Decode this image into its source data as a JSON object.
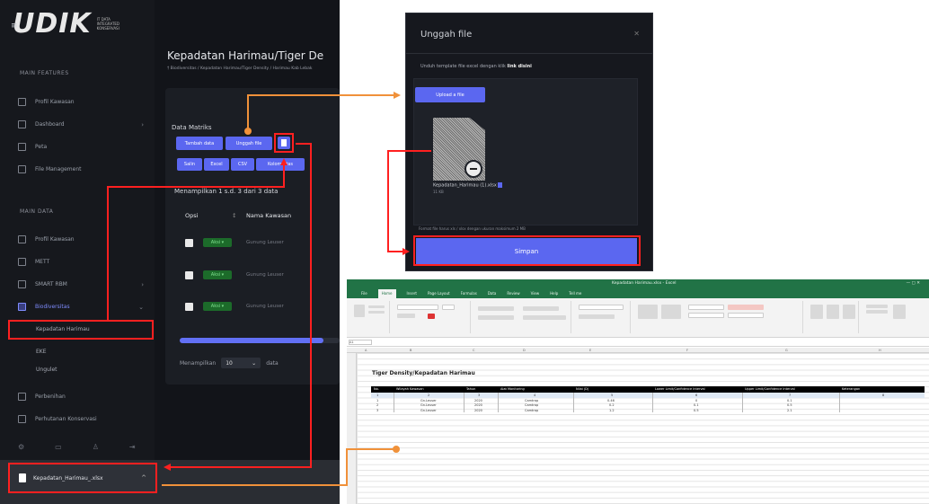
{
  "app": {
    "logo": "UDIK",
    "logo_tagline": "IT DATA INTEGRATED KONSERVASI",
    "sidebar": {
      "section_main": "MAIN FEATURES",
      "main_items": [
        {
          "label": "Profil Kawasan"
        },
        {
          "label": "Dashboard"
        },
        {
          "label": "Peta"
        },
        {
          "label": "File Management"
        }
      ],
      "section_data": "MAIN DATA",
      "data_items": [
        {
          "label": "Profil Kawasan"
        },
        {
          "label": "METT"
        },
        {
          "label": "SMART RBM"
        },
        {
          "label": "Biodiversitas"
        }
      ],
      "sub_items": [
        {
          "label": "Kepadatan Harimau"
        },
        {
          "label": "EKE"
        },
        {
          "label": "Ungulet"
        }
      ],
      "bottom_items": [
        {
          "label": "Perbenihan"
        },
        {
          "label": "Perhutanan Konservasi"
        }
      ]
    },
    "page_title": "Kepadatan Harimau/Tiger De",
    "breadcrumb": "† Biodiversitas  /  Kepadatan Harimau/Tiger Density  /  Harimau Kab Lebak",
    "data_label": "Data Matriks",
    "buttons": {
      "add": "Tambah data",
      "upload": "Unggah file",
      "exports": [
        "Salin",
        "Excel",
        "CSV",
        "Kolom Atas"
      ]
    },
    "showing": "Menampilkan 1 s.d. 3 dari 3 data",
    "table_headers": {
      "opsi": "Opsi",
      "nama": "Nama Kawasan"
    },
    "rows": [
      {
        "badge": "Aksi ▾",
        "text": "Gunung Leuser"
      },
      {
        "badge": "Aksi ▾",
        "text": "Gunung Leuser"
      },
      {
        "badge": "Aksi ▾",
        "text": "Gunung Leuser"
      }
    ],
    "progress": 0.9,
    "show_entries": {
      "prefix": "Menampilkan",
      "value": "10",
      "suffix": "data"
    },
    "download": {
      "filename": "Kepadatan_Harimau_.xlsx"
    }
  },
  "modal": {
    "title": "Unggah file",
    "hint_prefix": "Unduh template file excel dengan klik",
    "hint_bold": "link disini",
    "upload_button": "Upload a file",
    "file_name": "Kepadatan_Harimau (1).xlsx",
    "file_size": "11 KB",
    "note": "Format file harus xls / xlsx dengan ukuran maksimum 2 MB",
    "save_button": "Simpan"
  },
  "excel": {
    "window_title": "Kepadatan Harimau.xlsx - Excel",
    "window_controls": "— ▢ ✕",
    "tabs": [
      "File",
      "Home",
      "Insert",
      "Page Layout",
      "Formulas",
      "Data",
      "Review",
      "View",
      "Help",
      "Tell me"
    ],
    "name_box": "A1",
    "sheet_title": "Tiger Density/Kepadatan Harimau",
    "columns": [
      "No.",
      "Wilayah Kawasan",
      "Tahun",
      "Alat Monitoring",
      "Nilai (D)",
      "Lower Limit/Confidence Interval",
      "Upper Limit/Confidence Interval",
      "Keterangan"
    ],
    "rows": [
      [
        "1",
        "2",
        "3",
        "4",
        "5",
        "6",
        "7",
        "8"
      ],
      [
        "1",
        "Gn.Leuser",
        "2020",
        "Camtrap",
        "0.46",
        "0",
        "0.1",
        ""
      ],
      [
        "2",
        "Gn.Leuser",
        "2020",
        "Camtrap",
        "0.2",
        "0.1",
        "0.5",
        ""
      ],
      [
        "3",
        "Gn.Leuser",
        "2020",
        "Camtrap",
        "1.2",
        "0.5",
        "2.1",
        ""
      ]
    ],
    "col_letters": [
      "A",
      "B",
      "C",
      "D",
      "E",
      "F",
      "G",
      "H"
    ]
  },
  "colors": {
    "accent": "#5b67f0",
    "highlight": "#ff2020",
    "connector": "#f0913a",
    "excel_green": "#217346"
  }
}
